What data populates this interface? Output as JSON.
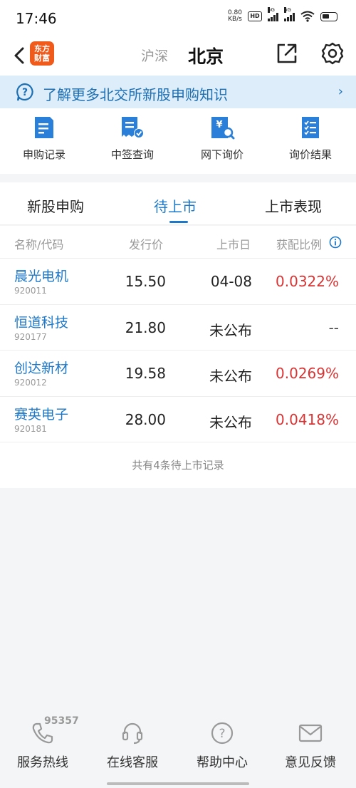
{
  "status_bar": {
    "time": "17:46",
    "net_speed_value": "0.80",
    "net_speed_unit": "KB/s",
    "hd_label": "HD",
    "signal_label_1": "5G",
    "signal_label_2": "5G"
  },
  "header": {
    "logo_text_line1": "东方",
    "logo_text_line2": "财富",
    "tab_hushen": "沪深",
    "tab_beijing": "北京"
  },
  "banner": {
    "text": "了解更多北交所新股申购知识",
    "arrow": "›"
  },
  "quick_menu": [
    {
      "label": "申购记录",
      "icon": "document-icon"
    },
    {
      "label": "中签查询",
      "icon": "receipt-check-icon"
    },
    {
      "label": "网下询价",
      "icon": "yen-search-icon"
    },
    {
      "label": "询价结果",
      "icon": "checklist-icon"
    }
  ],
  "sub_tabs": [
    {
      "label": "新股申购"
    },
    {
      "label": "待上市"
    },
    {
      "label": "上市表现"
    }
  ],
  "table": {
    "headers": [
      "名称/代码",
      "发行价",
      "上市日",
      "获配比例"
    ],
    "rows": [
      {
        "name": "晨光电机",
        "code": "920011",
        "price": "15.50",
        "date": "04-08",
        "ratio": "0.0322%"
      },
      {
        "name": "恒道科技",
        "code": "920177",
        "price": "21.80",
        "date": "未公布",
        "ratio": "--"
      },
      {
        "name": "创达新材",
        "code": "920012",
        "price": "19.58",
        "date": "未公布",
        "ratio": "0.0269%"
      },
      {
        "name": "赛英电子",
        "code": "920181",
        "price": "28.00",
        "date": "未公布",
        "ratio": "0.0418%"
      }
    ],
    "footnote": "共有4条待上市记录"
  },
  "bottom_bar": {
    "hotline_number": "95357",
    "items": [
      {
        "label": "服务热线",
        "icon": "phone-icon"
      },
      {
        "label": "在线客服",
        "icon": "headset-icon"
      },
      {
        "label": "帮助中心",
        "icon": "help-icon"
      },
      {
        "label": "意见反馈",
        "icon": "mail-icon"
      }
    ]
  },
  "colors": {
    "accent": "#1e78c8",
    "brand": "#f05a1a",
    "positive": "#d83434",
    "banner_bg": "#ddeefa"
  }
}
